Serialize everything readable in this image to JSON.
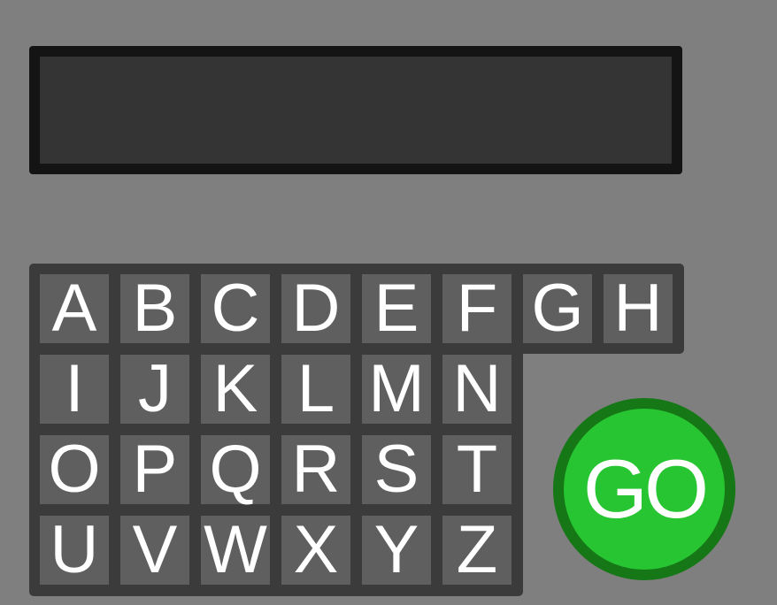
{
  "display": {
    "text": ""
  },
  "keyboard": {
    "rows": [
      [
        "A",
        "B",
        "C",
        "D",
        "E",
        "F",
        "G",
        "H"
      ],
      [
        "I",
        "J",
        "K",
        "L",
        "M",
        "N"
      ],
      [
        "O",
        "P",
        "Q",
        "R",
        "S",
        "T"
      ],
      [
        "U",
        "V",
        "W",
        "X",
        "Y",
        "Z"
      ]
    ]
  },
  "go_button": {
    "label": "GO"
  },
  "colors": {
    "background": "#7f7f7f",
    "display_border": "#141414",
    "display_fill": "#343434",
    "keyboard_panel": "#3b3b3b",
    "key_fill": "#5f5f5f",
    "key_text": "#ffffff",
    "go_fill": "#26c531",
    "go_border": "#167717"
  }
}
